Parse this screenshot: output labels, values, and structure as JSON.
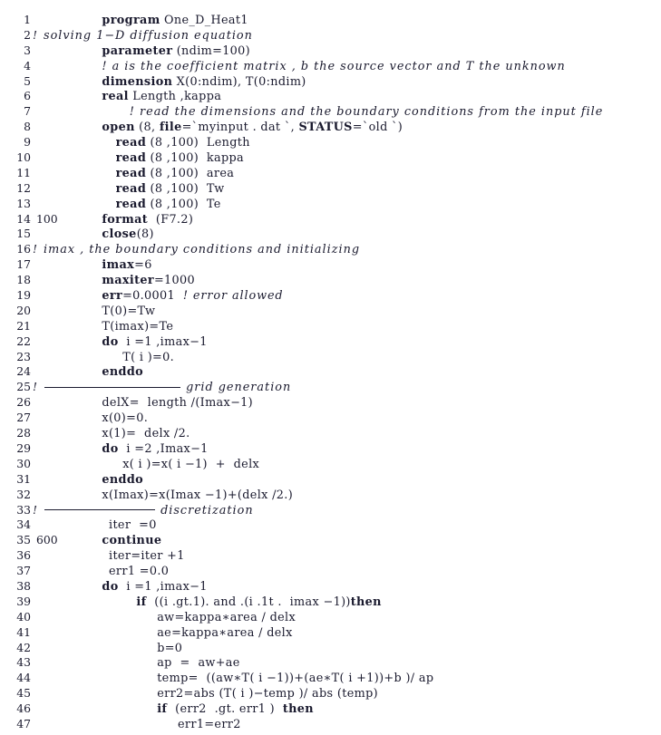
{
  "document": {
    "kind": "source-code-listing",
    "language": "Fortran",
    "program_name": "One_D_Heat1",
    "first_line_number": 1,
    "last_line_number": 47,
    "colors": {
      "background": "#ffffff",
      "text": "#1a1a2e",
      "line_number": "#1a1a2e"
    }
  },
  "lines": [
    {
      "n": "1",
      "label": "",
      "indent": 4,
      "segments": [
        {
          "t": "kw",
          "s": "program"
        },
        {
          "t": "id",
          "s": " One_D_Heat1"
        }
      ]
    },
    {
      "n": "2",
      "label": "!",
      "indent": 4,
      "segments": [
        {
          "t": "cm",
          "s": "solving 1−D diffusion equation"
        }
      ]
    },
    {
      "n": "3",
      "label": "",
      "indent": 4,
      "segments": [
        {
          "t": "kw",
          "s": "parameter"
        },
        {
          "t": "id",
          "s": " (ndim=100)"
        }
      ]
    },
    {
      "n": "4",
      "label": "",
      "indent": 4,
      "segments": [
        {
          "t": "cm",
          "s": "! a is the coefficient matrix , b the source vector and T the unknown"
        }
      ]
    },
    {
      "n": "5",
      "label": "",
      "indent": 4,
      "segments": [
        {
          "t": "kw",
          "s": "dimension"
        },
        {
          "t": "id",
          "s": " X(0:ndim), T(0:ndim)"
        }
      ]
    },
    {
      "n": "6",
      "label": "",
      "indent": 4,
      "segments": [
        {
          "t": "kw",
          "s": "real"
        },
        {
          "t": "id",
          "s": " Length ,kappa"
        }
      ]
    },
    {
      "n": "7",
      "label": "",
      "indent": 8,
      "segments": [
        {
          "t": "cm",
          "s": "! read the dimensions and the boundary conditions from the input file"
        }
      ]
    },
    {
      "n": "8",
      "label": "",
      "indent": 4,
      "segments": [
        {
          "t": "kw",
          "s": "open"
        },
        {
          "t": "id",
          "s": " (8, "
        },
        {
          "t": "kw",
          "s": "file"
        },
        {
          "t": "id",
          "s": "=ˋmyinput . dat ˋ, "
        },
        {
          "t": "kw",
          "s": "STATUS"
        },
        {
          "t": "id",
          "s": "=ˋold ˋ)"
        }
      ]
    },
    {
      "n": "9",
      "label": "",
      "indent": 6,
      "segments": [
        {
          "t": "kw",
          "s": "read"
        },
        {
          "t": "id",
          "s": " (8 ,100)  Length"
        }
      ]
    },
    {
      "n": "10",
      "label": "",
      "indent": 6,
      "segments": [
        {
          "t": "kw",
          "s": "read"
        },
        {
          "t": "id",
          "s": " (8 ,100)  kappa"
        }
      ]
    },
    {
      "n": "11",
      "label": "",
      "indent": 6,
      "segments": [
        {
          "t": "kw",
          "s": "read"
        },
        {
          "t": "id",
          "s": " (8 ,100)  area"
        }
      ]
    },
    {
      "n": "12",
      "label": "",
      "indent": 6,
      "segments": [
        {
          "t": "kw",
          "s": "read"
        },
        {
          "t": "id",
          "s": " (8 ,100)  Tw"
        }
      ]
    },
    {
      "n": "13",
      "label": "",
      "indent": 6,
      "segments": [
        {
          "t": "kw",
          "s": "read"
        },
        {
          "t": "id",
          "s": " (8 ,100)  Te"
        }
      ]
    },
    {
      "n": "14",
      "label": "100",
      "indent": 4,
      "segments": [
        {
          "t": "kw",
          "s": "format"
        },
        {
          "t": "id",
          "s": "  (F7.2)"
        }
      ]
    },
    {
      "n": "15",
      "label": "",
      "indent": 4,
      "segments": [
        {
          "t": "kw",
          "s": "close"
        },
        {
          "t": "id",
          "s": "(8)"
        }
      ]
    },
    {
      "n": "16",
      "label": "!",
      "indent": 4,
      "segments": [
        {
          "t": "cm",
          "s": "imax , the boundary conditions and initializing"
        }
      ]
    },
    {
      "n": "17",
      "label": "",
      "indent": 4,
      "segments": [
        {
          "t": "kw",
          "s": "imax"
        },
        {
          "t": "id",
          "s": "=6"
        }
      ]
    },
    {
      "n": "18",
      "label": "",
      "indent": 4,
      "segments": [
        {
          "t": "kw",
          "s": "maxiter"
        },
        {
          "t": "id",
          "s": "=1000"
        }
      ]
    },
    {
      "n": "19",
      "label": "",
      "indent": 4,
      "segments": [
        {
          "t": "kw",
          "s": "err"
        },
        {
          "t": "id",
          "s": "=0.0001  "
        },
        {
          "t": "cm-inline",
          "s": "! error allowed"
        }
      ]
    },
    {
      "n": "20",
      "label": "",
      "indent": 4,
      "segments": [
        {
          "t": "id",
          "s": "T(0)=Tw"
        }
      ]
    },
    {
      "n": "21",
      "label": "",
      "indent": 4,
      "segments": [
        {
          "t": "id",
          "s": "T(imax)=Te"
        }
      ]
    },
    {
      "n": "22",
      "label": "",
      "indent": 4,
      "segments": [
        {
          "t": "kw",
          "s": "do"
        },
        {
          "t": "id",
          "s": "  i =1 ,imax−1"
        }
      ]
    },
    {
      "n": "23",
      "label": "",
      "indent": 7,
      "segments": [
        {
          "t": "id",
          "s": "T( i )=0."
        }
      ]
    },
    {
      "n": "24",
      "label": "",
      "indent": 4,
      "segments": [
        {
          "t": "kw",
          "s": "enddo"
        }
      ]
    },
    {
      "n": "25",
      "label": "!",
      "indent": 0,
      "rule": "long",
      "segments": [
        {
          "t": "cm",
          "s": " grid generation"
        }
      ]
    },
    {
      "n": "26",
      "label": "",
      "indent": 4,
      "segments": [
        {
          "t": "id",
          "s": "delX=  length /(Imax−1)"
        }
      ]
    },
    {
      "n": "27",
      "label": "",
      "indent": 4,
      "segments": [
        {
          "t": "id",
          "s": "x(0)=0."
        }
      ]
    },
    {
      "n": "28",
      "label": "",
      "indent": 4,
      "segments": [
        {
          "t": "id",
          "s": "x(1)=  delx /2."
        }
      ]
    },
    {
      "n": "29",
      "label": "",
      "indent": 4,
      "segments": [
        {
          "t": "kw",
          "s": "do"
        },
        {
          "t": "id",
          "s": "  i =2 ,Imax−1"
        }
      ]
    },
    {
      "n": "30",
      "label": "",
      "indent": 7,
      "segments": [
        {
          "t": "id",
          "s": "x( i )=x( i −1)  +  delx"
        }
      ]
    },
    {
      "n": "31",
      "label": "",
      "indent": 4,
      "segments": [
        {
          "t": "kw",
          "s": "enddo"
        }
      ]
    },
    {
      "n": "32",
      "label": "",
      "indent": 4,
      "segments": [
        {
          "t": "id",
          "s": "x(Imax)=x(Imax −1)+(delx /2.)"
        }
      ]
    },
    {
      "n": "33",
      "label": "!",
      "indent": 0,
      "rule": "short",
      "segments": [
        {
          "t": "cm",
          "s": " discretization"
        }
      ]
    },
    {
      "n": "34",
      "label": "",
      "indent": 5,
      "segments": [
        {
          "t": "id",
          "s": "iter  =0"
        }
      ]
    },
    {
      "n": "35",
      "label": "600",
      "indent": 4,
      "segments": [
        {
          "t": "kw",
          "s": "continue"
        }
      ]
    },
    {
      "n": "36",
      "label": "",
      "indent": 5,
      "segments": [
        {
          "t": "id",
          "s": "iter=iter +1"
        }
      ]
    },
    {
      "n": "37",
      "label": "",
      "indent": 5,
      "segments": [
        {
          "t": "id",
          "s": "err1 =0.0"
        }
      ]
    },
    {
      "n": "38",
      "label": "",
      "indent": 4,
      "segments": [
        {
          "t": "kw",
          "s": "do"
        },
        {
          "t": "id",
          "s": "  i =1 ,imax−1"
        }
      ]
    },
    {
      "n": "39",
      "label": "",
      "indent": 9,
      "segments": [
        {
          "t": "kw",
          "s": "if"
        },
        {
          "t": "id",
          "s": "  ((i .gt.1). and .(i .1t .  imax −1))"
        },
        {
          "t": "kw",
          "s": "then"
        }
      ]
    },
    {
      "n": "40",
      "label": "",
      "indent": 12,
      "segments": [
        {
          "t": "id",
          "s": "aw=kappa∗area / delx"
        }
      ]
    },
    {
      "n": "41",
      "label": "",
      "indent": 12,
      "segments": [
        {
          "t": "id",
          "s": "ae=kappa∗area / delx"
        }
      ]
    },
    {
      "n": "42",
      "label": "",
      "indent": 12,
      "segments": [
        {
          "t": "id",
          "s": "b=0"
        }
      ]
    },
    {
      "n": "43",
      "label": "",
      "indent": 12,
      "segments": [
        {
          "t": "id",
          "s": "ap  =  aw+ae"
        }
      ]
    },
    {
      "n": "44",
      "label": "",
      "indent": 12,
      "segments": [
        {
          "t": "id",
          "s": "temp=  ((aw∗T( i −1))+(ae∗T( i +1))+b )/ ap"
        }
      ]
    },
    {
      "n": "45",
      "label": "",
      "indent": 12,
      "segments": [
        {
          "t": "id",
          "s": "err2=abs (T( i )−temp )/ abs (temp)"
        }
      ]
    },
    {
      "n": "46",
      "label": "",
      "indent": 12,
      "segments": [
        {
          "t": "kw",
          "s": "if"
        },
        {
          "t": "id",
          "s": "  (err2  .gt. err1 )  "
        },
        {
          "t": "kw",
          "s": "then"
        }
      ]
    },
    {
      "n": "47",
      "label": "",
      "indent": 15,
      "segments": [
        {
          "t": "id",
          "s": "err1=err2"
        }
      ]
    }
  ]
}
